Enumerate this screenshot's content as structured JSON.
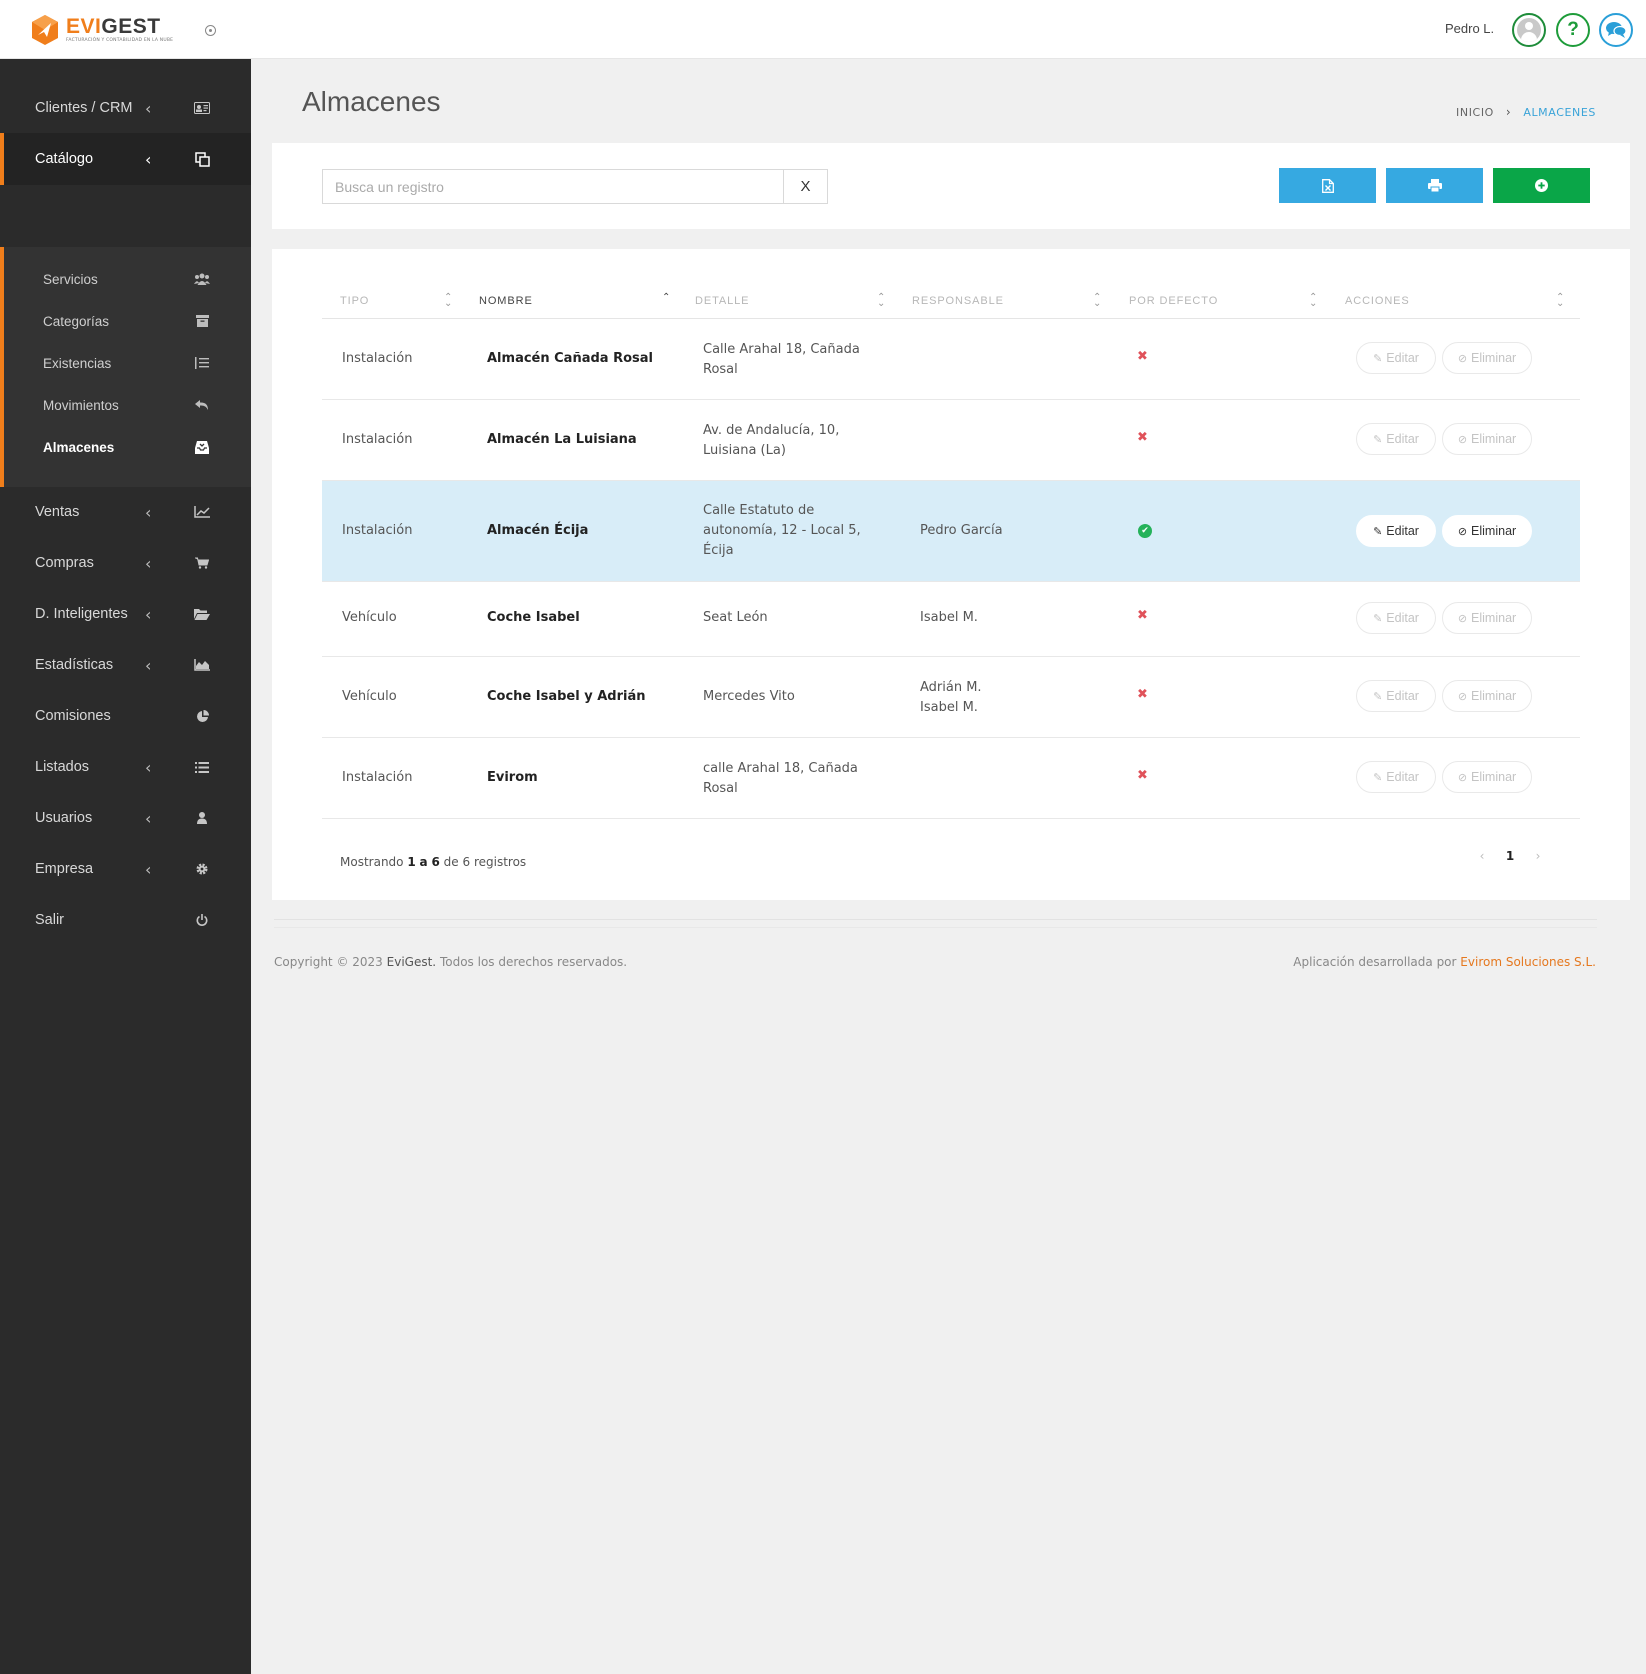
{
  "app": {
    "brand_evi": "EVI",
    "brand_gest": "GEST",
    "tagline": "FACTURACIÓN Y CONTABILIDAD EN LA NUBE",
    "accent_color": "#f07e1b"
  },
  "topbar": {
    "user_name": "Pedro L.",
    "help_label": "?"
  },
  "sidebar": {
    "items": [
      {
        "label": "Clientes / CRM",
        "chevron": "‹",
        "icon": "id-card-icon"
      },
      {
        "label": "Catálogo",
        "chevron": "‹",
        "icon": "copy-icon"
      },
      {
        "label": "Ventas",
        "chevron": "‹",
        "icon": "line-chart-icon"
      },
      {
        "label": "Compras",
        "chevron": "‹",
        "icon": "cart-icon"
      },
      {
        "label": "D. Inteligentes",
        "chevron": "‹",
        "icon": "folder-open-icon"
      },
      {
        "label": "Estadísticas",
        "chevron": "‹",
        "icon": "area-chart-icon"
      },
      {
        "label": "Comisiones",
        "chevron": "",
        "icon": "pie-chart-icon"
      },
      {
        "label": "Listados",
        "chevron": "‹",
        "icon": "list-icon"
      },
      {
        "label": "Usuarios",
        "chevron": "‹",
        "icon": "user-icon"
      },
      {
        "label": "Empresa",
        "chevron": "‹",
        "icon": "gear-icon"
      },
      {
        "label": "Salir",
        "chevron": "",
        "icon": "power-icon"
      }
    ],
    "submenu": [
      {
        "label": "Servicios",
        "icon": "users-icon"
      },
      {
        "label": "Categorías",
        "icon": "archive-icon"
      },
      {
        "label": "Existencias",
        "icon": "list-ol-icon"
      },
      {
        "label": "Movimientos",
        "icon": "reply-icon"
      },
      {
        "label": "Almacenes",
        "icon": "inbox-icon"
      }
    ]
  },
  "page": {
    "title": "Almacenes",
    "breadcrumb_home": "INICIO",
    "breadcrumb_current": "ALMACENES"
  },
  "toolbar": {
    "search_placeholder": "Busca un registro",
    "search_value": "",
    "clear_label": "X"
  },
  "table": {
    "columns": [
      "TIPO",
      "NOMBRE",
      "DETALLE",
      "RESPONSABLE",
      "POR DEFECTO",
      "ACCIONES"
    ],
    "edit_label": "Editar",
    "delete_label": "Eliminar",
    "rows": [
      {
        "tipo": "Instalación",
        "nombre": "Almacén Cañada Rosal",
        "detalle_1": "Calle Arahal 18, Cañada",
        "detalle_2": "Rosal",
        "detalle_3": "",
        "resp_1": "",
        "resp_2": "",
        "default": false,
        "mark": "✖"
      },
      {
        "tipo": "Instalación",
        "nombre": "Almacén La Luisiana",
        "detalle_1": "Av. de Andalucía, 10,",
        "detalle_2": "Luisiana (La)",
        "detalle_3": "",
        "resp_1": "",
        "resp_2": "",
        "default": false,
        "mark": "✖"
      },
      {
        "tipo": "Instalación",
        "nombre": "Almacén Écija",
        "detalle_1": "Calle Estatuto de",
        "detalle_2": "autonomía, 12 - Local 5,",
        "detalle_3": "Écija",
        "resp_1": "Pedro García",
        "resp_2": "",
        "default": true,
        "mark": "✔"
      },
      {
        "tipo": "Vehículo",
        "nombre": "Coche Isabel",
        "detalle_1": "Seat León",
        "detalle_2": "",
        "detalle_3": "",
        "resp_1": "Isabel M.",
        "resp_2": "",
        "default": false,
        "mark": "✖"
      },
      {
        "tipo": "Vehículo",
        "nombre": "Coche Isabel y Adrián",
        "detalle_1": "Mercedes Vito",
        "detalle_2": "",
        "detalle_3": "",
        "resp_1": "Adrián M.",
        "resp_2": "Isabel M.",
        "default": false,
        "mark": "✖"
      },
      {
        "tipo": "Instalación",
        "nombre": "Evirom",
        "detalle_1": "calle Arahal 18, Cañada",
        "detalle_2": "Rosal",
        "detalle_3": "",
        "resp_1": "",
        "resp_2": "",
        "default": false,
        "mark": "✖"
      }
    ],
    "info_prefix": "Mostrando",
    "info_from": "1",
    "info_a": "a",
    "info_to": "6",
    "info_de": "de",
    "info_total": "6",
    "info_suffix": "registros",
    "pager_prev": "‹",
    "pager_current": "1",
    "pager_next": "›"
  },
  "footer": {
    "copyright": "Copyright © 2023",
    "brand": "EviGest.",
    "rights": "Todos los derechos reservados.",
    "developed_by": "Aplicación desarrollada por",
    "developer": "Evirom Soluciones S.L."
  }
}
